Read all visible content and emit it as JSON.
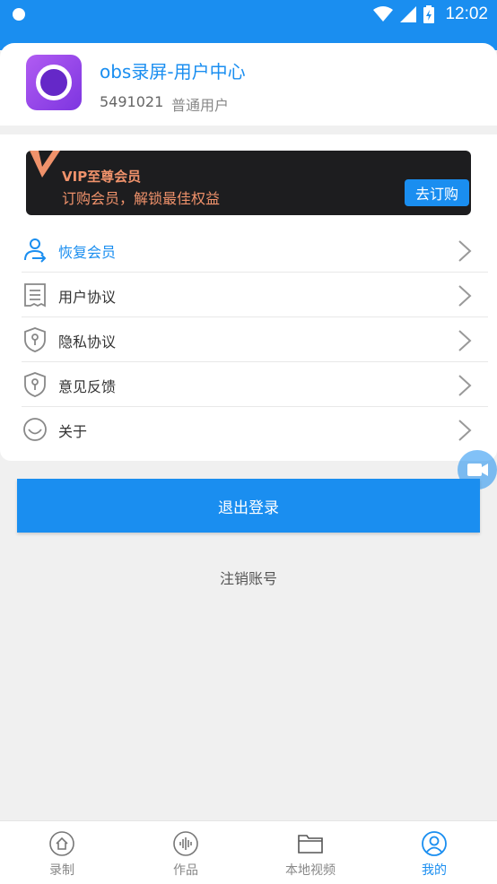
{
  "status_bar": {
    "time": "12:02"
  },
  "profile": {
    "app_title": "obs录屏-用户中心",
    "user_id": "5491021",
    "user_role": "普通用户"
  },
  "vip": {
    "title": "VIP至尊会员",
    "subtitle": "订购会员，解锁最佳权益",
    "button": "去订购"
  },
  "menu": {
    "items": [
      {
        "label": "恢复会员",
        "icon": "restore-user-icon"
      },
      {
        "label": "用户协议",
        "icon": "document-icon"
      },
      {
        "label": "隐私协议",
        "icon": "shield-icon"
      },
      {
        "label": "意见反馈",
        "icon": "shield-icon"
      },
      {
        "label": "关于",
        "icon": "smile-icon"
      }
    ]
  },
  "actions": {
    "logout": "退出登录",
    "cancel_account": "注销账号"
  },
  "tabs": [
    {
      "label": "录制",
      "icon": "home-icon"
    },
    {
      "label": "作品",
      "icon": "audio-wave-icon"
    },
    {
      "label": "本地视频",
      "icon": "folder-icon"
    },
    {
      "label": "我的",
      "icon": "user-icon"
    }
  ],
  "colors": {
    "accent": "#1a8ef0",
    "vip_text": "#f0926b",
    "vip_bg": "#1d1d1f"
  }
}
